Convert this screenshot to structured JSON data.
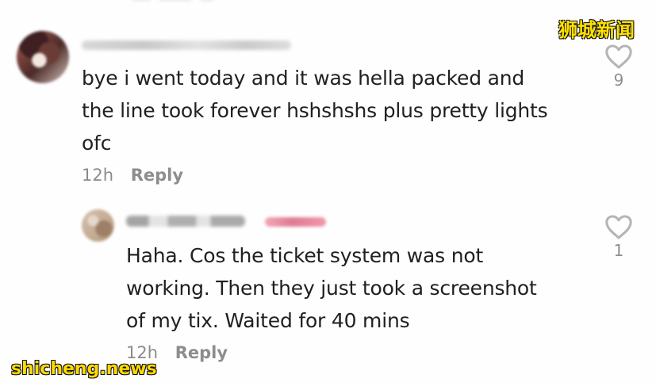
{
  "comments": [
    {
      "text_lines": [
        "bye i went today and it was hella packed and",
        "the line took forever hshshshs plus pretty lights",
        "ofc"
      ],
      "time": "12h",
      "reply_label": "Reply",
      "likes": "9",
      "like_icon": "heart-outline-icon"
    },
    {
      "text_lines": [
        "Haha. Cos the ticket system was not",
        "working. Then they just took a screenshot",
        "of my tix. Waited for 40 mins"
      ],
      "time": "12h",
      "reply_label": "Reply",
      "likes": "1",
      "like_icon": "heart-outline-icon"
    }
  ],
  "watermarks": {
    "top_right": "狮城新闻",
    "bottom_left": "shicheng.news"
  },
  "colors": {
    "background": "#fefefe",
    "text": "#202020",
    "meta": "#8b8b8b",
    "icon": "#b5b5b5",
    "watermark": "#ffe100"
  }
}
